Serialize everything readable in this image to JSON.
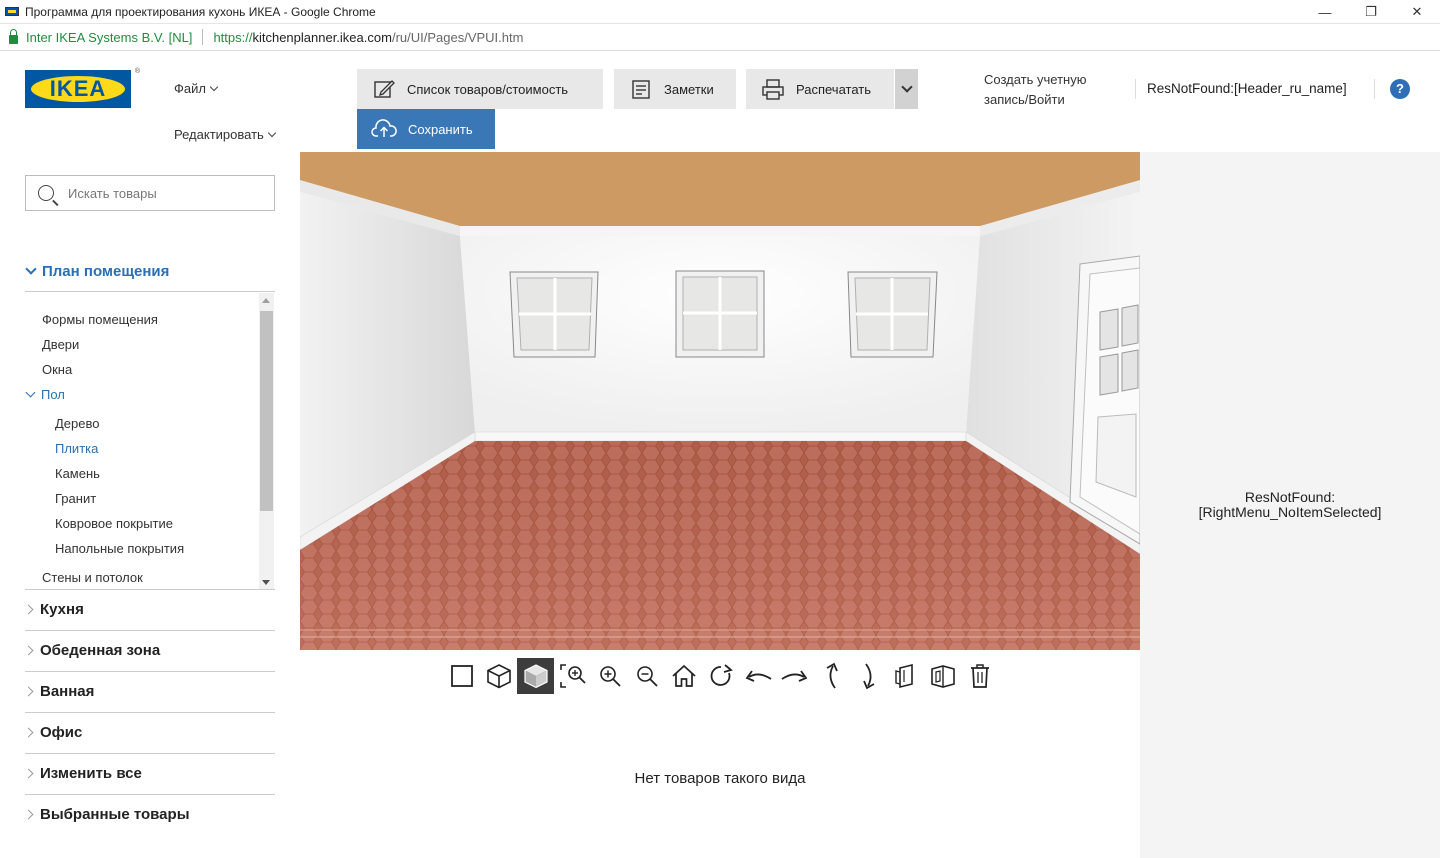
{
  "window": {
    "title": "Программа для проектирования кухонь ИКЕА - Google Chrome",
    "minimize": "—",
    "restore": "❐",
    "close": "✕"
  },
  "address": {
    "cert": "Inter IKEA Systems B.V. [NL]",
    "proto": "https://",
    "host": "kitchenplanner.ikea.com",
    "path": "/ru/UI/Pages/VPUI.htm"
  },
  "header": {
    "logo": "IKEA",
    "logo_reg": "®",
    "menu_file": "Файл",
    "menu_edit": "Редактировать",
    "btn_list": "Список товаров/стоимость",
    "btn_notes": "Заметки",
    "btn_print": "Распечатать",
    "btn_save": "Сохранить",
    "account": "Создать учетную запись/Войти",
    "name": "ResNotFound:[Header_ru_name]",
    "help": "?"
  },
  "sidebar": {
    "search_placeholder": "Искать товары",
    "open_section": "План помещения",
    "tree": [
      {
        "label": "Формы помещения",
        "level": 1
      },
      {
        "label": "Двери",
        "level": 1
      },
      {
        "label": "Окна",
        "level": 1
      },
      {
        "label": "Пол",
        "level": 1,
        "active": true,
        "expanded": true
      },
      {
        "label": "Дерево",
        "level": 2
      },
      {
        "label": "Плитка",
        "level": 2,
        "active": true
      },
      {
        "label": "Камень",
        "level": 2
      },
      {
        "label": "Гранит",
        "level": 2
      },
      {
        "label": "Ковровое покрытие",
        "level": 2
      },
      {
        "label": "Напольные покрытия",
        "level": 2
      },
      {
        "label": "Стены и потолок",
        "level": 1
      }
    ],
    "categories": [
      "Кухня",
      "Обеденная зона",
      "Ванная",
      "Офис",
      "Изменить все",
      "Выбранные товары"
    ]
  },
  "toolbar": {
    "tools": [
      "2d-view-icon",
      "3d-view-icon",
      "3d-solid-view-icon",
      "zoom-fit-icon",
      "zoom-in-icon",
      "zoom-out-icon",
      "home-icon",
      "rotate-icon",
      "pan-left-icon",
      "pan-right-icon",
      "tilt-up-icon",
      "tilt-down-icon",
      "hide-walls-icon",
      "show-walls-icon",
      "delete-icon"
    ],
    "selected": 2
  },
  "main": {
    "empty_message": "Нет товаров такого вида"
  },
  "right": {
    "line1": "ResNotFound:",
    "line2": "[RightMenu_NoItemSelected]"
  },
  "colors": {
    "accent": "#3a77b6",
    "ceiling": "#cc9a62",
    "floor": "#b8604c",
    "ikea_blue": "#0058a3",
    "ikea_yellow": "#ffda1a"
  }
}
